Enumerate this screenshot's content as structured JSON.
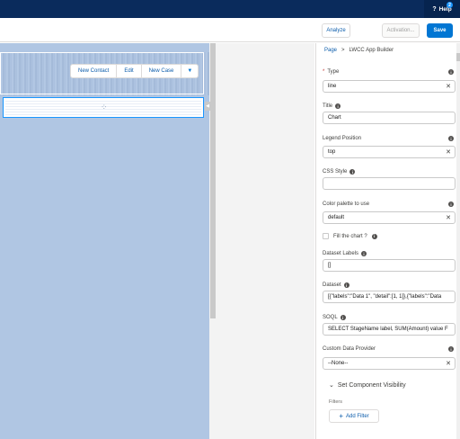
{
  "header": {
    "help_label": "Help",
    "help_badge": "2",
    "help_icon": "question-icon"
  },
  "toolbar": {
    "analyze_label": "Analyze",
    "activation_label": "Activation...",
    "save_label": "Save"
  },
  "canvas": {
    "actions": [
      "New Contact",
      "Edit",
      "New Case"
    ],
    "dropdown_icon": "chevron-down-icon",
    "spinner_glyph": "⁘"
  },
  "panel": {
    "breadcrumb": {
      "page": "Page",
      "separator": ">",
      "current": "LWCC App Builder"
    },
    "type": {
      "required_mark": "*",
      "label": "Type",
      "value": "line"
    },
    "title": {
      "label": "Title",
      "value": "Chart"
    },
    "legend_position": {
      "label": "Legend Position",
      "value": "top"
    },
    "css_style": {
      "label": "CSS Style",
      "value": ""
    },
    "color_palette": {
      "label": "Color palette to use",
      "value": "default"
    },
    "fill_chart": {
      "label": "Fill the chart ?",
      "checked": false
    },
    "dataset_labels": {
      "label": "Dataset Labels",
      "value": "[]"
    },
    "dataset": {
      "label": "Dataset",
      "value": "[{\"labels\":\"Data 1\", \"detail\":[1, 1]},{\"labels\":\"Data"
    },
    "soql": {
      "label": "SOQL",
      "value": "SELECT StageName label, SUM(Amount) value F"
    },
    "custom_data_provider": {
      "label": "Custom Data Provider",
      "value": "--None--"
    },
    "visibility_section": {
      "label": "Set Component Visibility",
      "filters_label": "Filters",
      "add_filter_label": "Add Filter"
    }
  },
  "colors": {
    "nav": "#0a2b5c",
    "brand": "#0176d3",
    "canvas_page": "#b0c6e3"
  }
}
